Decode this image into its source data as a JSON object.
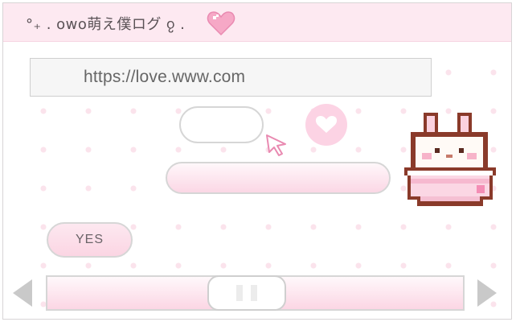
{
  "window": {
    "title": "°₊ . owo萌え僕ログ ჹ ."
  },
  "address_bar": {
    "url": "https://love.www.com"
  },
  "buttons": {
    "yes_label": "YES"
  },
  "icons": {
    "title_heart": "heart-icon",
    "like": "heart-icon",
    "cursor": "cursor-arrow-icon",
    "mascot": "bunny-icon",
    "scroll_left": "triangle-left-icon",
    "scroll_right": "triangle-right-icon"
  },
  "colors": {
    "accent_pink": "#fcd3e4",
    "heart_pink": "#f08fb6",
    "titlebar_bg": "#fde9f1",
    "border_gray": "#d6d6d6"
  },
  "scrollbar": {
    "position": 0.19
  }
}
